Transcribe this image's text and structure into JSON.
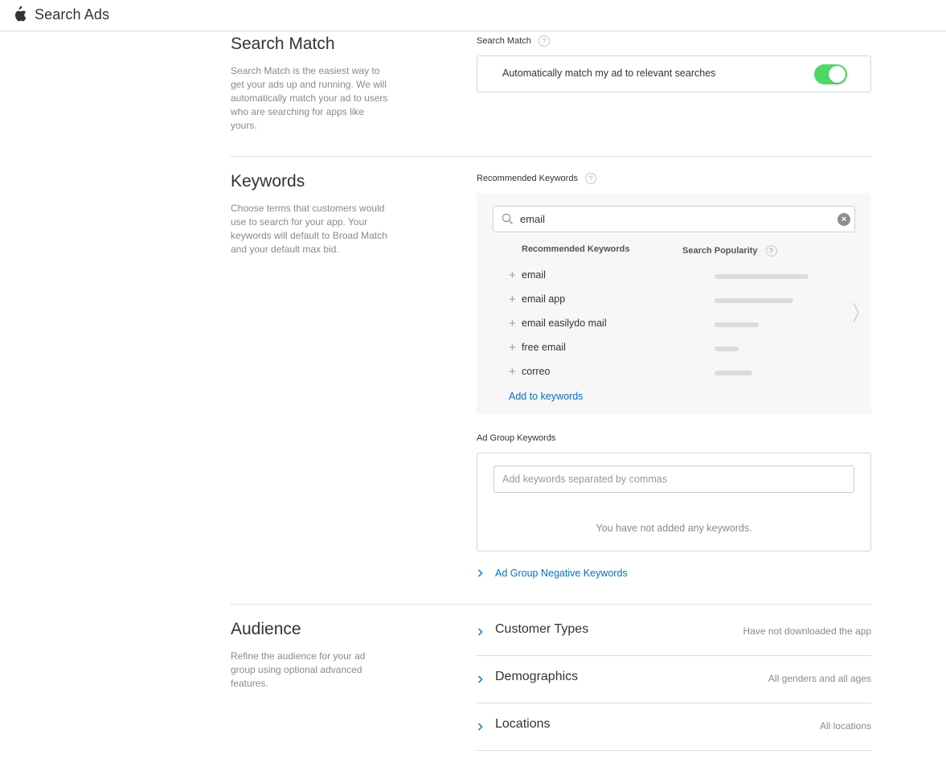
{
  "header": {
    "brand": "Search Ads"
  },
  "search_match": {
    "title": "Search Match",
    "description": "Search Match is the easiest way to get your ads up and running. We will automatically match your ad to users who are searching for apps like yours.",
    "field_label": "Search Match",
    "toggle_label": "Automatically match my ad to relevant searches",
    "toggle_on": true
  },
  "keywords": {
    "title": "Keywords",
    "description": "Choose terms that customers would use to search for your app. Your keywords will default to Broad Match and your default max bid.",
    "recommended_label": "Recommended Keywords",
    "search_value": "email",
    "col_keywords": "Recommended Keywords",
    "col_popularity": "Search Popularity",
    "items": [
      {
        "keyword": "email",
        "popularity": 0.95
      },
      {
        "keyword": "email app",
        "popularity": 0.8
      },
      {
        "keyword": "email easilydo mail",
        "popularity": 0.45
      },
      {
        "keyword": "free email",
        "popularity": 0.24
      },
      {
        "keyword": "correo",
        "popularity": 0.38
      }
    ],
    "add_link": "Add to keywords",
    "ad_group_label": "Ad Group Keywords",
    "ad_group_placeholder": "Add keywords separated by commas",
    "ad_group_empty": "You have not added any keywords.",
    "negative_link": "Ad Group Negative Keywords"
  },
  "audience": {
    "title": "Audience",
    "description": "Refine the audience for your ad group using optional advanced features.",
    "rows": [
      {
        "title": "Customer Types",
        "value": "Have not downloaded the app"
      },
      {
        "title": "Demographics",
        "value": "All genders and all ages"
      },
      {
        "title": "Locations",
        "value": "All locations"
      }
    ]
  },
  "colors": {
    "accent": "#0070c9",
    "toggle": "#4cd964"
  }
}
